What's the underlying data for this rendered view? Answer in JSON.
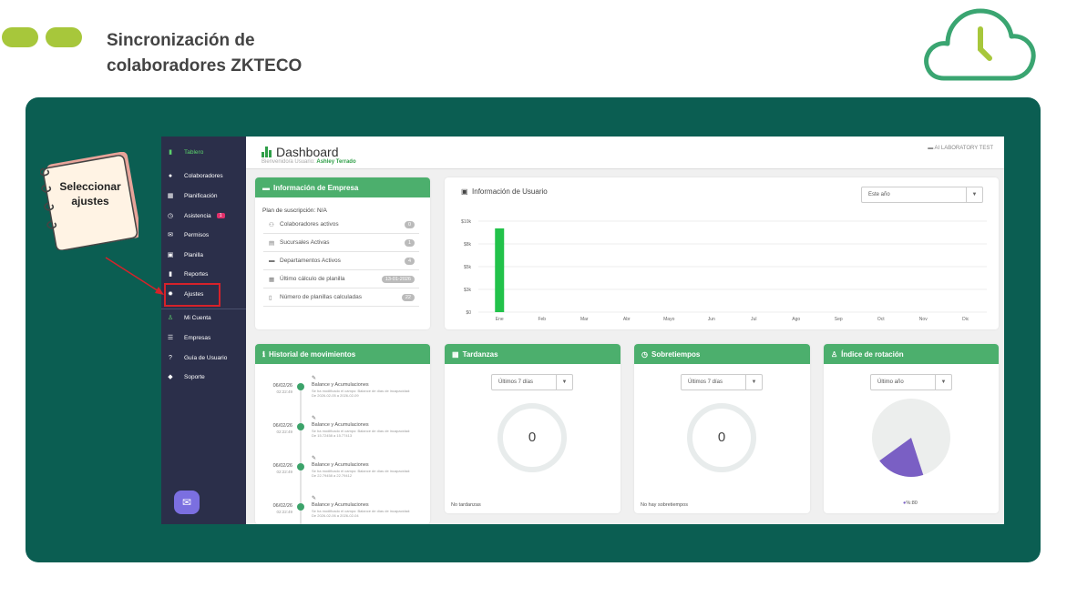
{
  "slide": {
    "title_line1": "Sincronización de",
    "title_line2": "colaboradores ZKTECO",
    "note_line1": "Seleccionar",
    "note_line2": "ajustes",
    "accent_color": "#a7c73b",
    "panel_color": "#0b5e52",
    "highlight_color": "#d6222a"
  },
  "sidebar": {
    "items": [
      {
        "label": "Tablero",
        "icon": "bar-chart-icon"
      },
      {
        "label": "Colaboradores",
        "icon": "users-icon"
      },
      {
        "label": "Planificación",
        "icon": "calendar-icon"
      },
      {
        "label": "Asistencia",
        "icon": "clock-icon",
        "badge": "1"
      },
      {
        "label": "Permisos",
        "icon": "envelope-icon"
      },
      {
        "label": "Planilla",
        "icon": "money-icon"
      },
      {
        "label": "Reportes",
        "icon": "file-icon"
      },
      {
        "label": "Ajustes",
        "icon": "gear-icon"
      },
      {
        "label": "Mi Cuenta",
        "icon": "user-icon"
      },
      {
        "label": "Empresas",
        "icon": "sliders-icon"
      },
      {
        "label": "Guía de Usuario",
        "icon": "help-icon"
      },
      {
        "label": "Soporte",
        "icon": "shield-icon"
      }
    ]
  },
  "header": {
    "title": "Dashboard",
    "welcome_prefix": "Bienvenido/a Usuario:",
    "user_name": "Ashley Terrado",
    "company": "AI LABORATORY TEST"
  },
  "empresa": {
    "title": "Información de Empresa",
    "plan": "Plan de suscripción: N/A",
    "rows": [
      {
        "label": "Colaboradores activos",
        "badge": "0"
      },
      {
        "label": "Sucursales Activas",
        "badge": "1"
      },
      {
        "label": "Departamentos Activos",
        "badge": "4"
      },
      {
        "label": "Último cálculo de planilla",
        "badge": "13-01-2026"
      },
      {
        "label": "Número de planillas calculadas",
        "badge": "22"
      }
    ]
  },
  "usuario": {
    "title": "Información de Usuario",
    "select_value": "Este año"
  },
  "chart_data": {
    "type": "bar",
    "categories": [
      "Ene",
      "Feb",
      "Mar",
      "Abr",
      "Mayo",
      "Jun",
      "Jul",
      "Ago",
      "Sep",
      "Oct",
      "Nov",
      "Dic"
    ],
    "values": [
      9200,
      0,
      0,
      0,
      0,
      0,
      0,
      0,
      0,
      0,
      0,
      0
    ],
    "yticks": [
      "$10k",
      "$8k",
      "$5k",
      "$3k",
      "$0"
    ],
    "ytick_values": [
      10000,
      7500,
      5000,
      2500,
      0
    ],
    "ylim": [
      0,
      10000
    ],
    "bar_color": "#22c24a",
    "grid": true
  },
  "historial": {
    "title": "Historial de movimientos",
    "items": [
      {
        "date": "06/02/26",
        "time": "02:22:49",
        "title": "Balance y Acumulaciones",
        "desc": "Se ha modificado el campo: Balance de días de incapacidad: De 2026-02-05 a 2026-02-09"
      },
      {
        "date": "06/02/26",
        "time": "02:22:49",
        "title": "Balance y Acumulaciones",
        "desc": "Se ha modificado el campo: Balance de días de incapacidad: De 15.72458 a 15.77413"
      },
      {
        "date": "06/02/26",
        "time": "02:22:49",
        "title": "Balance y Acumulaciones",
        "desc": "Se ha modificado el campo: Balance de días de incapacidad: De 22.79458 a 22.79412"
      },
      {
        "date": "06/02/26",
        "time": "02:22:49",
        "title": "Balance y Acumulaciones",
        "desc": "Se ha modificado el campo: Balance de días de incapacidad: De 2026-02-06 a 2026-02-04"
      }
    ]
  },
  "tardanzas": {
    "title": "Tardanzas",
    "select_value": "Últimos 7 días",
    "value": "0",
    "footer": "No tardanzas"
  },
  "sobretiempos": {
    "title": "Sobretiempos",
    "select_value": "Últimos 7 días",
    "value": "0",
    "footer": "No hay sobretiempos"
  },
  "rotacion": {
    "title": "Índice de rotación",
    "select_value": "Último año",
    "legend": "%:80",
    "slice_fraction": 0.2,
    "slice_color": "#7a5fc4",
    "rest_color": "#eceeed"
  }
}
